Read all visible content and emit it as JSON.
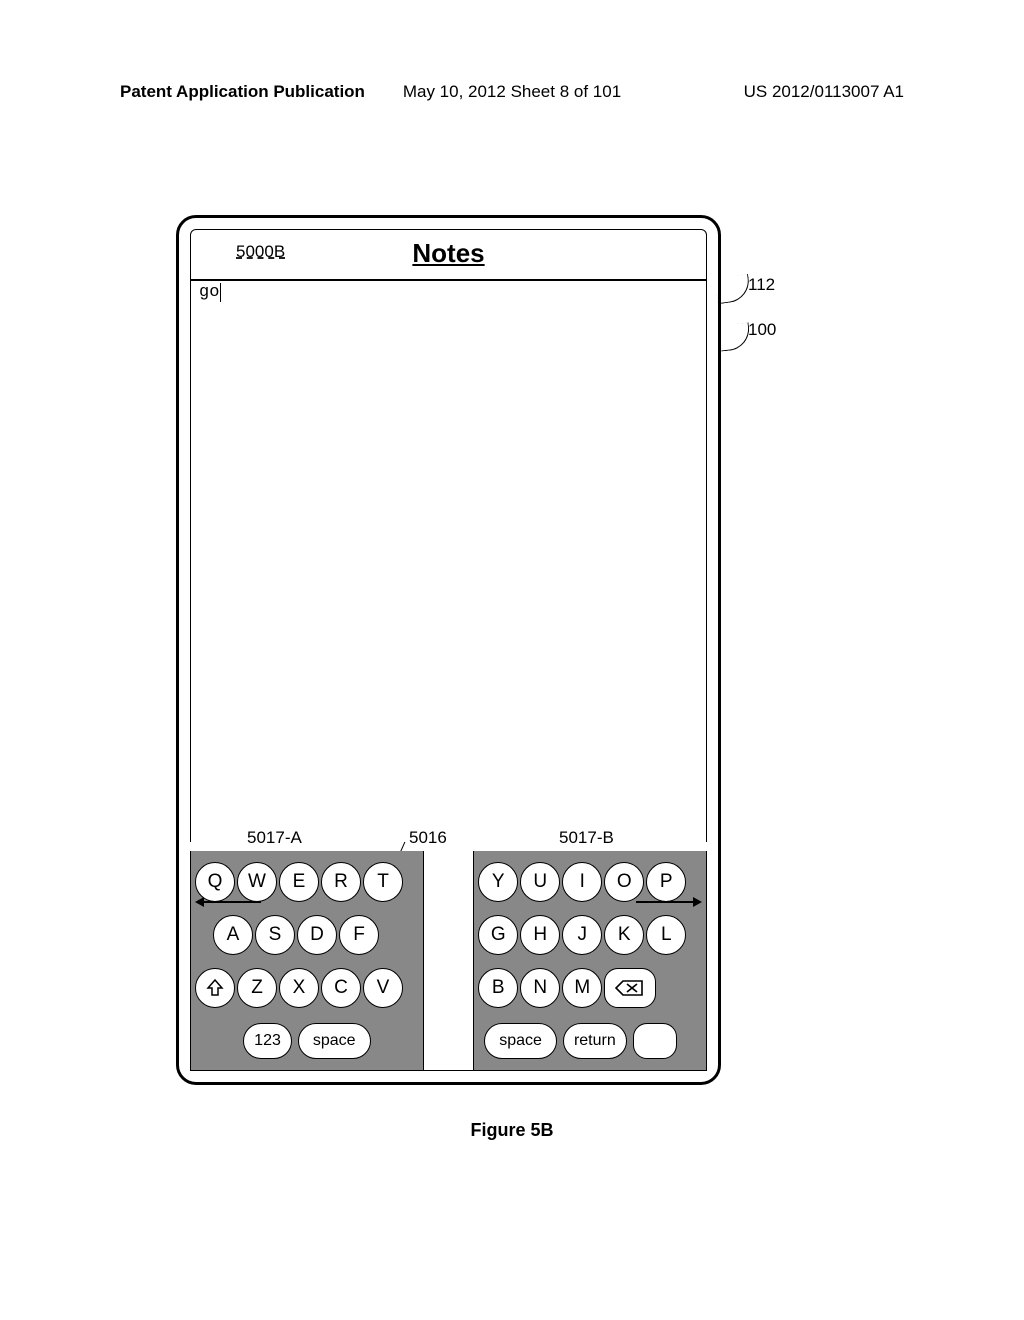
{
  "header": {
    "left": "Patent Application Publication",
    "center": "May 10, 2012  Sheet 8 of 101",
    "right": "US 2012/0113007 A1"
  },
  "device": {
    "screen_ref": "5000B",
    "title": "Notes",
    "typed_text": "go"
  },
  "callouts": {
    "c112": "112",
    "c100": "100",
    "kb_left": "5017-A",
    "kb_center": "5016",
    "kb_right": "5017-B"
  },
  "keyboard": {
    "left": {
      "row1": [
        "Q",
        "W",
        "E",
        "R",
        "T"
      ],
      "row2": [
        "A",
        "S",
        "D",
        "F"
      ],
      "row3": [
        "Z",
        "X",
        "C",
        "V"
      ],
      "numkey": "123",
      "space": "space"
    },
    "right": {
      "row1": [
        "Y",
        "U",
        "I",
        "O",
        "P"
      ],
      "row2": [
        "G",
        "H",
        "J",
        "K",
        "L"
      ],
      "row3": [
        "B",
        "N",
        "M"
      ],
      "space": "space",
      "return": "return"
    }
  },
  "figure": "Figure 5B"
}
